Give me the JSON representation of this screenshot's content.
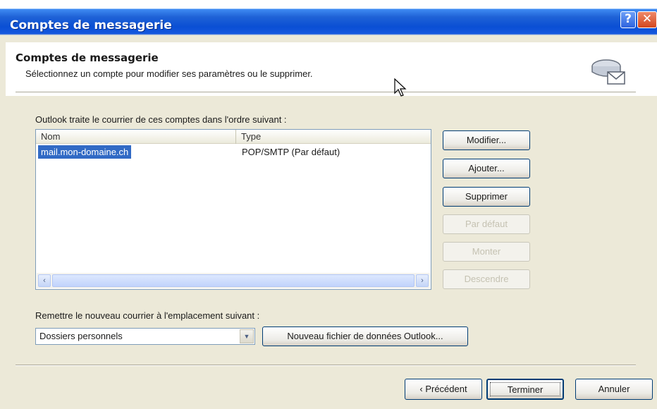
{
  "window": {
    "title": "Comptes de messagerie",
    "help_glyph": "?",
    "close_glyph": "✕"
  },
  "header": {
    "title": "Comptes de messagerie",
    "subtitle": "Sélectionnez un compte pour modifier ses paramètres ou le supprimer.",
    "icon": "mail-accounts-icon"
  },
  "accounts": {
    "caption": "Outlook traite le courrier de ces comptes dans l'ordre suivant :",
    "columns": [
      "Nom",
      "Type"
    ],
    "rows": [
      {
        "name": "mail.mon-domaine.ch",
        "type": "POP/SMTP (Par défaut)",
        "selected": true
      }
    ],
    "scroll_left": "‹",
    "scroll_right": "›"
  },
  "side_buttons": {
    "modify": "Modifier...",
    "add": "Ajouter...",
    "remove": "Supprimer",
    "set_default": "Par défaut",
    "move_up": "Monter",
    "move_down": "Descendre"
  },
  "delivery": {
    "caption": "Remettre le nouveau courrier à l'emplacement suivant :",
    "selected": "Dossiers personnels",
    "new_data_file_button": "Nouveau fichier de données Outlook..."
  },
  "footer": {
    "previous": "‹ Précédent",
    "finish": "Terminer",
    "cancel": "Annuler"
  },
  "colors": {
    "titlebar": "#0a4fd4",
    "selection": "#316ac5",
    "dialog_bg": "#ece9d8"
  }
}
